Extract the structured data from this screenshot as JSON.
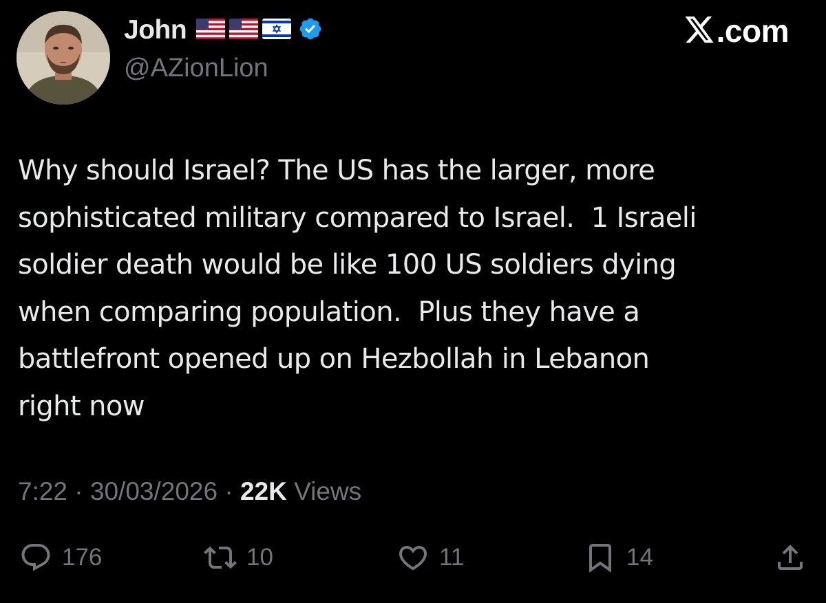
{
  "author": {
    "display_name": "John",
    "handle": "@AZionLion",
    "badges": [
      "us-flag-icon",
      "us-flag-icon",
      "israel-flag-icon",
      "verified-badge-icon"
    ]
  },
  "brand": {
    "label": ".com",
    "logo": "x-logo-icon"
  },
  "tweet": {
    "text": "Why should Israel? The US has the larger, more\nsophisticated military compared to Israel.  1 Israeli\nsoldier death would be like 100 US soldiers dying\nwhen comparing population.  Plus they have a\nbattlefront opened up on Hezbollah in Lebanon\nright now",
    "time": "7:22",
    "separator": " · ",
    "date": "30/03/2026",
    "views_count": "22K",
    "views_label": " Views"
  },
  "actions": {
    "replies": "176",
    "reposts": "10",
    "likes": "11",
    "bookmarks": "14"
  },
  "colors": {
    "background": "#000000",
    "text": "#e7e9ea",
    "muted": "#71767b",
    "verified": "#1d9bf0"
  }
}
